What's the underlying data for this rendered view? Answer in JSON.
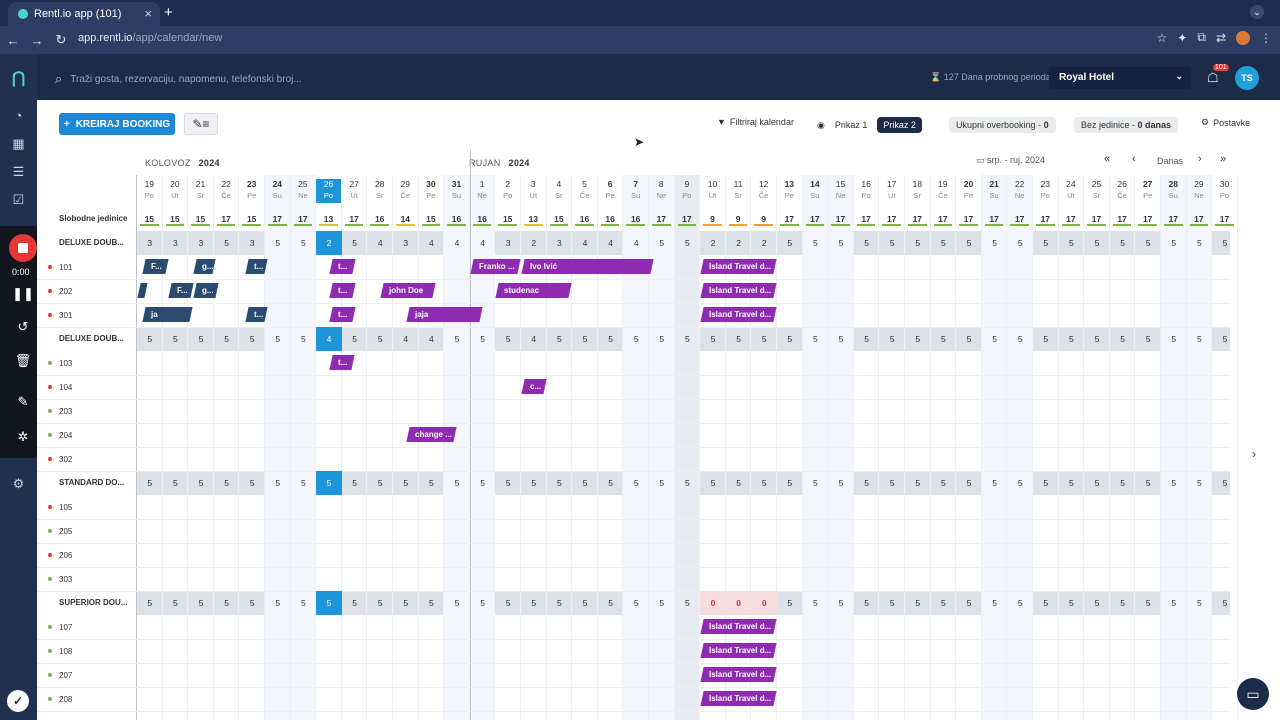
{
  "browser": {
    "tab_title": "Rentl.io app (101)",
    "url_host": "app.rentl.io",
    "url_path": "/app/calendar/new"
  },
  "topbar": {
    "search_placeholder": "Traži gosta, rezervaciju, napomenu, telefonski broj...",
    "trial": "127 Dana probnog perioda",
    "hotel": "Royal Hotel",
    "notif_count": "101",
    "user_initials": "TS"
  },
  "recorder": {
    "time": "0:00"
  },
  "toolbar": {
    "create_label": "KREIRAJ BOOKING",
    "filter_label": "Filtriraj kalendar",
    "view1": "Prikaz 1",
    "view2": "Prikaz 2",
    "overbooking_label": "Ukupni overbooking",
    "overbooking_value": "0",
    "nounit_label": "Bez jedinice",
    "nounit_value": "0 danas",
    "settings_label": "Postavke"
  },
  "calendar": {
    "month1": "KOLOVOZ",
    "year1": "2024",
    "month2": "RUJAN",
    "year2": "2024",
    "period": "srp. - ruj. 2024",
    "today": "Danas",
    "free_units_label": "Slobodne jedinice",
    "days": [
      [
        "19",
        "Po"
      ],
      [
        "20",
        "Ut"
      ],
      [
        "21",
        "Sr"
      ],
      [
        "22",
        "Če"
      ],
      [
        "23",
        "Pe"
      ],
      [
        "24",
        "Su"
      ],
      [
        "25",
        "Ne"
      ],
      [
        "26",
        "Po"
      ],
      [
        "27",
        "Ut"
      ],
      [
        "28",
        "Sr"
      ],
      [
        "29",
        "Če"
      ],
      [
        "30",
        "Pe"
      ],
      [
        "31",
        "Su"
      ],
      [
        "1",
        "Ne"
      ],
      [
        "2",
        "Po"
      ],
      [
        "3",
        "Ut"
      ],
      [
        "4",
        "Sr"
      ],
      [
        "5",
        "Če"
      ],
      [
        "6",
        "Pe"
      ],
      [
        "7",
        "Su"
      ],
      [
        "8",
        "Ne"
      ],
      [
        "9",
        "Po"
      ],
      [
        "10",
        "Ut"
      ],
      [
        "11",
        "Sr"
      ],
      [
        "12",
        "Če"
      ],
      [
        "13",
        "Pe"
      ],
      [
        "14",
        "Su"
      ],
      [
        "15",
        "Ne"
      ],
      [
        "16",
        "Po"
      ],
      [
        "17",
        "Ut"
      ],
      [
        "18",
        "Sr"
      ],
      [
        "19",
        "Če"
      ],
      [
        "20",
        "Pe"
      ],
      [
        "21",
        "Su"
      ],
      [
        "22",
        "Ne"
      ],
      [
        "23",
        "Po"
      ],
      [
        "24",
        "Ut"
      ],
      [
        "25",
        "Sr"
      ],
      [
        "26",
        "Če"
      ],
      [
        "27",
        "Pe"
      ],
      [
        "28",
        "Su"
      ],
      [
        "29",
        "Ne"
      ],
      [
        "30",
        "Po"
      ]
    ],
    "free_units": [
      "15",
      "15",
      "15",
      "17",
      "15",
      "17",
      "17",
      "13",
      "17",
      "16",
      "14",
      "15",
      "16",
      "16",
      "15",
      "13",
      "15",
      "16",
      "16",
      "16",
      "17",
      "17",
      "9",
      "9",
      "9",
      "17",
      "17",
      "17",
      "17",
      "17",
      "17",
      "17",
      "17",
      "17",
      "17",
      "17",
      "17",
      "17",
      "17",
      "17",
      "17",
      "17",
      "17"
    ],
    "groups": [
      {
        "name": "DELUXE DOUB...",
        "counts": [
          "3",
          "3",
          "3",
          "5",
          "3",
          "5",
          "5",
          "2",
          "5",
          "4",
          "3",
          "4",
          "4",
          "4",
          "3",
          "2",
          "3",
          "4",
          "4",
          "4",
          "5",
          "5",
          "2",
          "2",
          "2",
          "5",
          "5",
          "5",
          "5",
          "5",
          "5",
          "5",
          "5",
          "5",
          "5",
          "5",
          "5",
          "5",
          "5",
          "5",
          "5",
          "5",
          "5"
        ],
        "rooms": [
          {
            "name": "101",
            "dot": "#e53935"
          },
          {
            "name": "202",
            "dot": "#e53935"
          },
          {
            "name": "301",
            "dot": "#e53935"
          }
        ]
      },
      {
        "name": "DELUXE DOUB...",
        "counts": [
          "5",
          "5",
          "5",
          "5",
          "5",
          "5",
          "5",
          "4",
          "5",
          "5",
          "4",
          "4",
          "5",
          "5",
          "5",
          "4",
          "5",
          "5",
          "5",
          "5",
          "5",
          "5",
          "5",
          "5",
          "5",
          "5",
          "5",
          "5",
          "5",
          "5",
          "5",
          "5",
          "5",
          "5",
          "5",
          "5",
          "5",
          "5",
          "5",
          "5",
          "5",
          "5",
          "5"
        ],
        "rooms": [
          {
            "name": "103",
            "dot": "#7cb342"
          },
          {
            "name": "104",
            "dot": "#e53935"
          },
          {
            "name": "203",
            "dot": "#7cb342"
          },
          {
            "name": "204",
            "dot": "#7cb342"
          },
          {
            "name": "302",
            "dot": "#e53935"
          }
        ]
      },
      {
        "name": "STANDARD DO...",
        "counts": [
          "5",
          "5",
          "5",
          "5",
          "5",
          "5",
          "5",
          "5",
          "5",
          "5",
          "5",
          "5",
          "5",
          "5",
          "5",
          "5",
          "5",
          "5",
          "5",
          "5",
          "5",
          "5",
          "5",
          "5",
          "5",
          "5",
          "5",
          "5",
          "5",
          "5",
          "5",
          "5",
          "5",
          "5",
          "5",
          "5",
          "5",
          "5",
          "5",
          "5",
          "5",
          "5",
          "5"
        ],
        "rooms": [
          {
            "name": "105",
            "dot": "#e53935"
          },
          {
            "name": "205",
            "dot": "#7cb342"
          },
          {
            "name": "206",
            "dot": "#e53935"
          },
          {
            "name": "303",
            "dot": "#7cb342"
          }
        ]
      },
      {
        "name": "SUPERIOR DOU...",
        "counts": [
          "5",
          "5",
          "5",
          "5",
          "5",
          "5",
          "5",
          "5",
          "5",
          "5",
          "5",
          "5",
          "5",
          "5",
          "5",
          "5",
          "5",
          "5",
          "5",
          "5",
          "5",
          "5",
          "0",
          "0",
          "0",
          "5",
          "5",
          "5",
          "5",
          "5",
          "5",
          "5",
          "5",
          "5",
          "5",
          "5",
          "5",
          "5",
          "5",
          "5",
          "5",
          "5",
          "5"
        ],
        "rooms": [
          {
            "name": "107",
            "dot": "#7cb342"
          },
          {
            "name": "108",
            "dot": "#7cb342"
          },
          {
            "name": "207",
            "dot": "#7cb342"
          },
          {
            "name": "208",
            "dot": "#7cb342"
          }
        ]
      }
    ],
    "bookings": [
      {
        "row": 1,
        "start": 0.2,
        "len": 1.05,
        "label": "F...",
        "color": "#2b4a6f"
      },
      {
        "row": 1,
        "start": 2.2,
        "len": 0.9,
        "label": "g...",
        "color": "#2b4a6f"
      },
      {
        "row": 1,
        "start": 4.2,
        "len": 0.9,
        "label": "t...",
        "color": "#2b4a6f"
      },
      {
        "row": 1,
        "start": 7.5,
        "len": 1.05,
        "label": "t...",
        "color": "#8e2bb0"
      },
      {
        "row": 1,
        "start": 13.0,
        "len": 2.0,
        "label": "Franko ...",
        "color": "#8e2bb0"
      },
      {
        "row": 1,
        "start": 15.0,
        "len": 5.2,
        "label": "Ivo Ivić",
        "color": "#8e2bb0"
      },
      {
        "row": 1,
        "start": 22.0,
        "len": 3.0,
        "label": "Island Travel d...",
        "color": "#8e2bb0"
      },
      {
        "row": 2,
        "start": 0.0,
        "len": 0.2,
        "label": "",
        "color": "#2b4a6f"
      },
      {
        "row": 2,
        "start": 1.2,
        "len": 1.0,
        "label": "F...",
        "color": "#2b4a6f"
      },
      {
        "row": 2,
        "start": 2.2,
        "len": 1.0,
        "label": "g...",
        "color": "#2b4a6f"
      },
      {
        "row": 2,
        "start": 7.5,
        "len": 1.05,
        "label": "t...",
        "color": "#8e2bb0"
      },
      {
        "row": 2,
        "start": 9.5,
        "len": 2.2,
        "label": "john Doe",
        "color": "#8e2bb0"
      },
      {
        "row": 2,
        "start": 14.0,
        "len": 3.0,
        "label": "studenac",
        "color": "#8e2bb0"
      },
      {
        "row": 2,
        "start": 22.0,
        "len": 3.0,
        "label": "Island Travel d...",
        "color": "#8e2bb0"
      },
      {
        "row": 3,
        "start": 0.2,
        "len": 2.0,
        "label": "ja",
        "color": "#2b4a6f"
      },
      {
        "row": 3,
        "start": 4.2,
        "len": 0.9,
        "label": "t...",
        "color": "#2b4a6f"
      },
      {
        "row": 3,
        "start": 7.5,
        "len": 1.05,
        "label": "t...",
        "color": "#8e2bb0"
      },
      {
        "row": 3,
        "start": 10.5,
        "len": 3.0,
        "label": "jaja",
        "color": "#8e2bb0"
      },
      {
        "row": 3,
        "start": 22.0,
        "len": 3.0,
        "label": "Island Travel d...",
        "color": "#8e2bb0"
      },
      {
        "row": 5,
        "start": 7.5,
        "len": 1.0,
        "label": "t...",
        "color": "#8e2bb0"
      },
      {
        "row": 6,
        "start": 15.0,
        "len": 1.0,
        "label": "c...",
        "color": "#8e2bb0"
      },
      {
        "row": 8,
        "start": 10.5,
        "len": 2.0,
        "label": "change ...",
        "color": "#8e2bb0"
      },
      {
        "row": 16,
        "start": 22.0,
        "len": 3.0,
        "label": "Island Travel d...",
        "color": "#8e2bb0"
      },
      {
        "row": 17,
        "start": 22.0,
        "len": 3.0,
        "label": "Island Travel d...",
        "color": "#8e2bb0"
      },
      {
        "row": 18,
        "start": 22.0,
        "len": 3.0,
        "label": "Island Travel d...",
        "color": "#8e2bb0"
      },
      {
        "row": 19,
        "start": 22.0,
        "len": 3.0,
        "label": "Island Travel d...",
        "color": "#8e2bb0"
      }
    ]
  }
}
